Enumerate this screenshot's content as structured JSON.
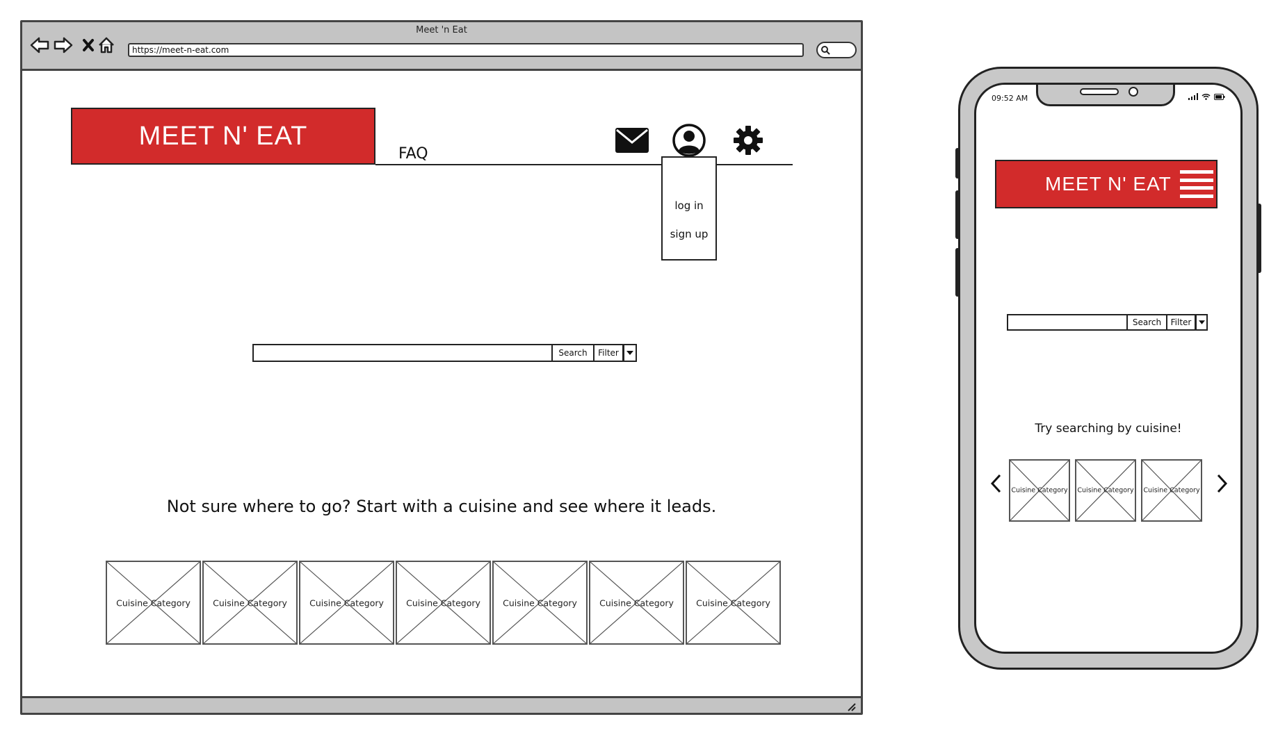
{
  "browser": {
    "window_title": "Meet 'n Eat",
    "url": "https://meet-n-eat.com",
    "nav_icons": [
      "back-arrow-icon",
      "forward-arrow-icon",
      "close-icon",
      "home-icon"
    ]
  },
  "header": {
    "brand": "MEET N' EAT",
    "faq_label": "FAQ",
    "icons": [
      "mail-icon",
      "user-account-icon",
      "gear-icon"
    ]
  },
  "account_menu": {
    "items": [
      "log in",
      "sign up"
    ]
  },
  "search": {
    "value": "",
    "search_label": "Search",
    "filter_label": "Filter"
  },
  "tagline": "Not sure where to go? Start with a cuisine and see where it leads.",
  "cuisine_tiles": [
    "Cuisine Category",
    "Cuisine Category",
    "Cuisine Category",
    "Cuisine Category",
    "Cuisine Category",
    "Cuisine Category",
    "Cuisine Category"
  ],
  "phone": {
    "time": "09:52 AM",
    "brand": "MEET N' EAT",
    "search_label": "Search",
    "filter_label": "Filter",
    "caption": "Try searching by cuisine!",
    "cuisine_tiles": [
      "Cuisine Category",
      "Cuisine Category",
      "Cuisine Category"
    ]
  },
  "colors": {
    "brand_red": "#d22b2b",
    "chrome_gray": "#c4c4c4"
  }
}
